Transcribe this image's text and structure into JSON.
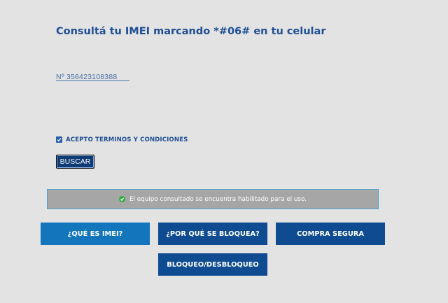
{
  "heading": "Consultá tu IMEI marcando *#06# en tu celular",
  "imei_input": {
    "placeholder": "Nº 356423108388",
    "value": ""
  },
  "terms": {
    "label": "ACEPTO TERMINOS Y CONDICIONES",
    "checked": true
  },
  "search_button": "BUSCAR",
  "status": {
    "message": "El equipo consultado se encuentra habilitado para el uso.",
    "icon": "check-circle-icon",
    "color": "#2fae3f"
  },
  "nav_buttons": {
    "que_es_imei": "¿QUÉ ES IMEI?",
    "por_que_se_bloquea": "¿POR QUÉ SE BLOQUEA?",
    "compra_segura": "COMPRA SEGURA",
    "bloqueo_desbloqueo": "BLOQUEO/DESBLOQUEO"
  },
  "colors": {
    "heading": "#1e4e94",
    "primary_button": "#0e4b90",
    "highlight_button": "#1376bd",
    "background": "#e3e3e3"
  }
}
